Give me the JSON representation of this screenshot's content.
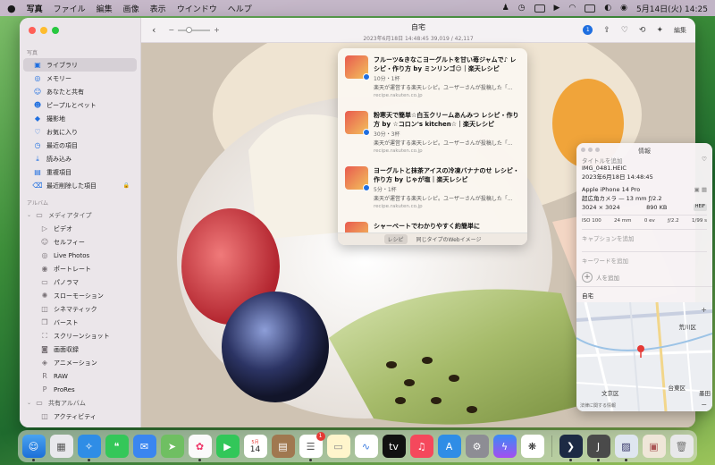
{
  "menubar": {
    "app": "写真",
    "items": [
      "ファイル",
      "編集",
      "画像",
      "表示",
      "ウインドウ",
      "ヘルプ"
    ],
    "datetime": "5月14日(火)  14:25"
  },
  "toolbar": {
    "title": "自宅",
    "subtitle": "2023年6月18日 14:48:45    39,019 / 42,117",
    "edit_label": "編集",
    "badge_count": "1",
    "zoom_minus": "−",
    "zoom_plus": "+"
  },
  "sidebar": {
    "section_photos": "写真",
    "photos_items": [
      {
        "label": "ライブラリ",
        "icon": "library-icon"
      },
      {
        "label": "メモリー",
        "icon": "memories-icon"
      },
      {
        "label": "あなたと共有",
        "icon": "shared-with-you-icon"
      },
      {
        "label": "ピープルとペット",
        "icon": "people-icon"
      },
      {
        "label": "撮影地",
        "icon": "places-icon"
      },
      {
        "label": "お気に入り",
        "icon": "heart-icon"
      },
      {
        "label": "最近の項目",
        "icon": "clock-icon"
      },
      {
        "label": "読み込み",
        "icon": "import-icon"
      },
      {
        "label": "重複項目",
        "icon": "duplicates-icon"
      },
      {
        "label": "最近削除した項目",
        "icon": "trash-icon"
      }
    ],
    "section_albums": "アルバム",
    "media_types_label": "メディアタイプ",
    "media_items": [
      {
        "label": "ビデオ",
        "icon": "video-icon"
      },
      {
        "label": "セルフィー",
        "icon": "selfie-icon"
      },
      {
        "label": "Live Photos",
        "icon": "live-photo-icon"
      },
      {
        "label": "ポートレート",
        "icon": "portrait-icon"
      },
      {
        "label": "パノラマ",
        "icon": "panorama-icon"
      },
      {
        "label": "スローモーション",
        "icon": "slomo-icon"
      },
      {
        "label": "シネマティック",
        "icon": "cinematic-icon"
      },
      {
        "label": "バースト",
        "icon": "burst-icon"
      },
      {
        "label": "スクリーンショット",
        "icon": "screenshot-icon"
      },
      {
        "label": "画面収録",
        "icon": "screen-record-icon"
      },
      {
        "label": "アニメーション",
        "icon": "animation-icon"
      },
      {
        "label": "RAW",
        "icon": "raw-icon"
      },
      {
        "label": "ProRes",
        "icon": "prores-icon"
      }
    ],
    "shared_albums_label": "共有アルバム",
    "activity_label": "アクティビティ"
  },
  "lookup": {
    "results": [
      {
        "title": "フルーツ&きなこヨーグルトを甘い苺ジャムで♪ レシピ・作り方 by ミンリンゴ☺︎｜楽天レシピ",
        "meta": "10分・1杯",
        "desc": "楽天が運営する楽天レシピ。ユーザーさんが投稿した「...",
        "url": "recipe.rakuten.co.jp"
      },
      {
        "title": "粉寒天で簡単☆白玉クリームあんみつ レシピ・作り方 by ☆コロン's kitchen☆｜楽天レシピ",
        "meta": "30分・3杯",
        "desc": "楽天が運営する楽天レシピ。ユーザーさんが投稿した「...",
        "url": "recipe.rakuten.co.jp"
      },
      {
        "title": "ヨーグルトと抹茶アイスの冷凍バナナのせ レシピ・作り方 by じゃが塩｜楽天レシピ",
        "meta": "5分・1杯",
        "desc": "楽天が運営する楽天レシピ。ユーザーさんが投稿した「...",
        "url": "recipe.rakuten.co.jp"
      },
      {
        "title": "シャーベートでわかりやすく約簡単に",
        "meta": "",
        "desc": "",
        "url": ""
      }
    ],
    "footer_recipe": "レシピ",
    "footer_similar": "同じタイプのWebイメージ"
  },
  "info": {
    "header": "情報",
    "add_title": "タイトルを追加",
    "filename": "IMG_0481.HEIC",
    "date": "2023年6月18日   14:48:45",
    "device": "Apple iPhone 14 Pro",
    "lens": "超広角カメラ — 13 mm ƒ/2.2",
    "dimensions": "3024 × 3024",
    "size": "890 KB",
    "format": "HEIF",
    "iso": "ISO 100",
    "focal": "24 mm",
    "ev": "0 ev",
    "aperture": "ƒ/2.2",
    "shutter": "1/99 s",
    "caption_placeholder": "キャプションを追加",
    "keyword_placeholder": "キーワードを追加",
    "add_person": "人を追加",
    "location": "自宅",
    "map_labels": {
      "arakawa": "荒川区",
      "taito": "台東区",
      "bunkyo": "文京区",
      "sumida": "墨田"
    },
    "map_footer": "法律に関する情報"
  },
  "dock": {
    "calendar_month": "5月",
    "calendar_day": "14",
    "reminders_badge": "1",
    "icons": [
      "finder-icon",
      "launchpad-icon",
      "safari-icon",
      "messages-icon",
      "mail-icon",
      "maps-icon",
      "photos-icon",
      "facetime-icon",
      "calendar-icon",
      "notes-brown-icon",
      "reminders-icon",
      "notes-icon",
      "freeform-icon",
      "appletv-icon",
      "music-icon",
      "appstore-icon",
      "settings-icon",
      "messenger-icon",
      "chatgpt-icon",
      "cursor-icon",
      "j-app-icon",
      "preview-icon",
      "photos-folder-icon",
      "trash-icon"
    ]
  }
}
